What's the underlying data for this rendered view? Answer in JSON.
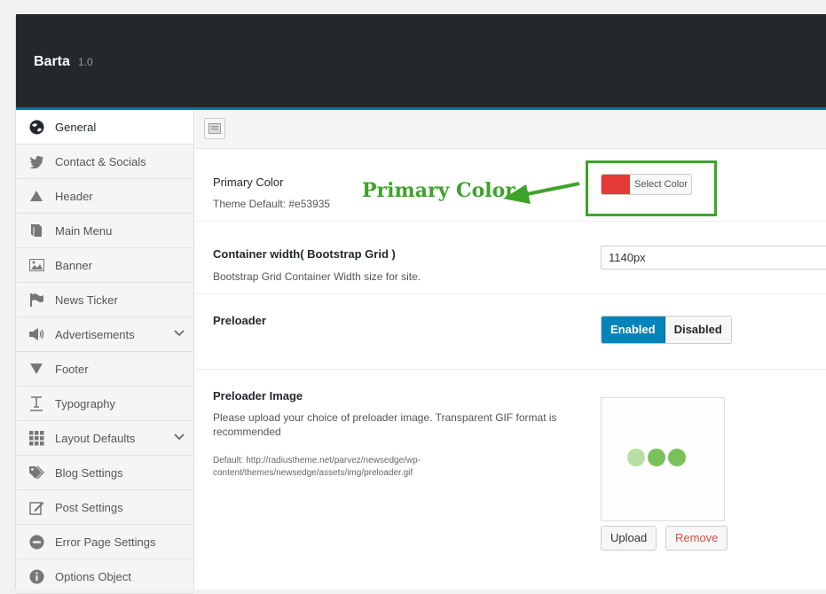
{
  "app": {
    "title": "Barta",
    "version": "1.0"
  },
  "sidebar": {
    "items": [
      {
        "label": "General",
        "icon": "globe-icon",
        "active": true
      },
      {
        "label": "Contact & Socials",
        "icon": "twitter-icon"
      },
      {
        "label": "Header",
        "icon": "triangle-up-icon"
      },
      {
        "label": "Main Menu",
        "icon": "book-icon"
      },
      {
        "label": "Banner",
        "icon": "image-icon"
      },
      {
        "label": "News Ticker",
        "icon": "flag-icon"
      },
      {
        "label": "Advertisements",
        "icon": "megaphone-icon",
        "expandable": true
      },
      {
        "label": "Footer",
        "icon": "triangle-down-icon"
      },
      {
        "label": "Typography",
        "icon": "text-icon"
      },
      {
        "label": "Layout Defaults",
        "icon": "grid-icon",
        "expandable": true
      },
      {
        "label": "Blog Settings",
        "icon": "tags-icon"
      },
      {
        "label": "Post Settings",
        "icon": "edit-icon"
      },
      {
        "label": "Error Page Settings",
        "icon": "no-entry-icon"
      },
      {
        "label": "Options Object",
        "icon": "info-icon"
      }
    ]
  },
  "settings": {
    "primary_color": {
      "label": "Primary Color",
      "desc": "Theme Default: #e53935",
      "button_label": "Select Color",
      "value": "#e53935",
      "annotation": "Primary Color"
    },
    "container_width": {
      "label": "Container width( Bootstrap Grid )",
      "desc": "Bootstrap Grid Container Width size for site.",
      "value": "1140px"
    },
    "preloader": {
      "label": "Preloader",
      "enabled_label": "Enabled",
      "disabled_label": "Disabled",
      "selected": "Enabled"
    },
    "preloader_image": {
      "label": "Preloader Image",
      "desc": "Please upload your choice of preloader image. Transparent GIF format is recommended",
      "default_text": "Default: http://radiustheme.net/parvez/newsedge/wp-content/themes/newsedge/assets/img/preloader.gif",
      "upload_label": "Upload",
      "remove_label": "Remove"
    }
  },
  "colors": {
    "accent": "#0073aa",
    "annotation": "#3ea32a",
    "primary": "#e53935",
    "toggle_on": "#0085ba"
  }
}
